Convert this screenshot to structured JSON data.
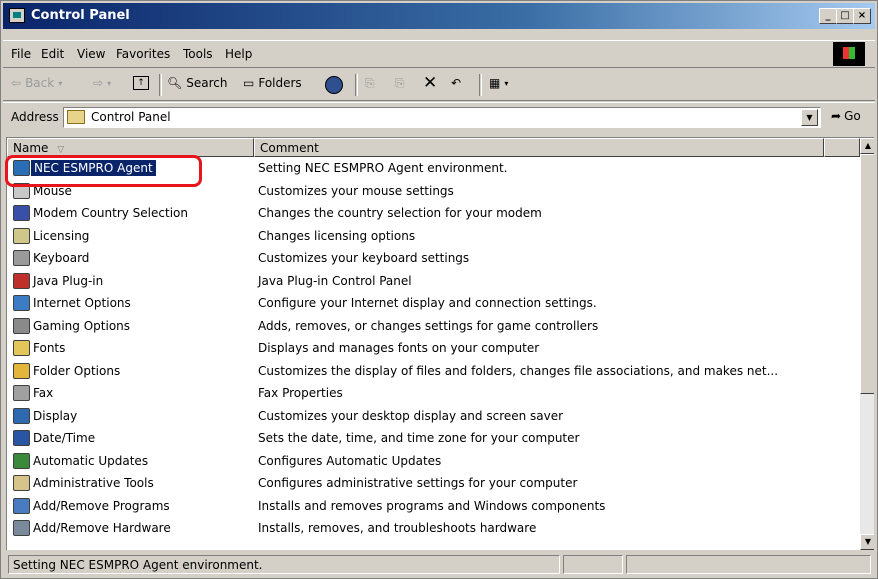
{
  "window": {
    "title": "Control Panel",
    "controls": [
      "_",
      "□",
      "×"
    ]
  },
  "menu": [
    "File",
    "Edit",
    "View",
    "Favorites",
    "Tools",
    "Help"
  ],
  "toolbar": {
    "back": "Back",
    "forward_arrow": "⇨",
    "search": "Search",
    "folders": "Folders"
  },
  "address": {
    "label": "Address",
    "value": "Control Panel",
    "go": "Go"
  },
  "columns": {
    "name": "Name",
    "comment": "Comment"
  },
  "items": [
    {
      "name": "NEC ESMPRO Agent",
      "comment": "Setting NEC ESMPRO Agent environment.",
      "icon": "esmpro-icon",
      "color": "#2a6fb6"
    },
    {
      "name": "Mouse",
      "comment": "Customizes your mouse settings",
      "icon": "mouse-icon",
      "color": "#c8c8c8"
    },
    {
      "name": "Modem Country Selection",
      "comment": "Changes the country selection for your modem",
      "icon": "globe-icon",
      "color": "#3a4fa8"
    },
    {
      "name": "Licensing",
      "comment": "Changes licensing options",
      "icon": "licensing-icon",
      "color": "#cfc68a"
    },
    {
      "name": "Keyboard",
      "comment": "Customizes your keyboard settings",
      "icon": "keyboard-icon",
      "color": "#9a9a9a"
    },
    {
      "name": "Java Plug-in",
      "comment": "Java Plug-in Control Panel",
      "icon": "java-icon",
      "color": "#c0302a"
    },
    {
      "name": "Internet Options",
      "comment": "Configure your Internet display and connection settings.",
      "icon": "internet-icon",
      "color": "#3c7cc4"
    },
    {
      "name": "Gaming Options",
      "comment": "Adds, removes, or changes settings for game controllers",
      "icon": "joystick-icon",
      "color": "#8a8a8a"
    },
    {
      "name": "Fonts",
      "comment": "Displays and manages fonts on your computer",
      "icon": "fonts-icon",
      "color": "#e2c65a"
    },
    {
      "name": "Folder Options",
      "comment": "Customizes the display of files and folders, changes file associations, and makes net...",
      "icon": "folder-options-icon",
      "color": "#e3b53a"
    },
    {
      "name": "Fax",
      "comment": "Fax Properties",
      "icon": "fax-icon",
      "color": "#a0a0a0"
    },
    {
      "name": "Display",
      "comment": "Customizes your desktop display and screen saver",
      "icon": "display-icon",
      "color": "#2f6ab0"
    },
    {
      "name": "Date/Time",
      "comment": "Sets the date, time, and time zone for your computer",
      "icon": "calendar-icon",
      "color": "#2a54a4"
    },
    {
      "name": "Automatic Updates",
      "comment": "Configures Automatic Updates",
      "icon": "updates-icon",
      "color": "#3b8a3b"
    },
    {
      "name": "Administrative Tools",
      "comment": "Configures administrative settings for your computer",
      "icon": "admin-tools-icon",
      "color": "#d6c48a"
    },
    {
      "name": "Add/Remove Programs",
      "comment": "Installs and removes programs and Windows components",
      "icon": "add-remove-programs-icon",
      "color": "#4a7ac0"
    },
    {
      "name": "Add/Remove Hardware",
      "comment": "Installs, removes, and troubleshoots hardware",
      "icon": "add-remove-hardware-icon",
      "color": "#7a8a9a"
    }
  ],
  "status": {
    "text": "Setting NEC ESMPRO Agent environment."
  },
  "colors": {
    "selection": "#0a246a",
    "highlight_ring": "#e8141c"
  }
}
